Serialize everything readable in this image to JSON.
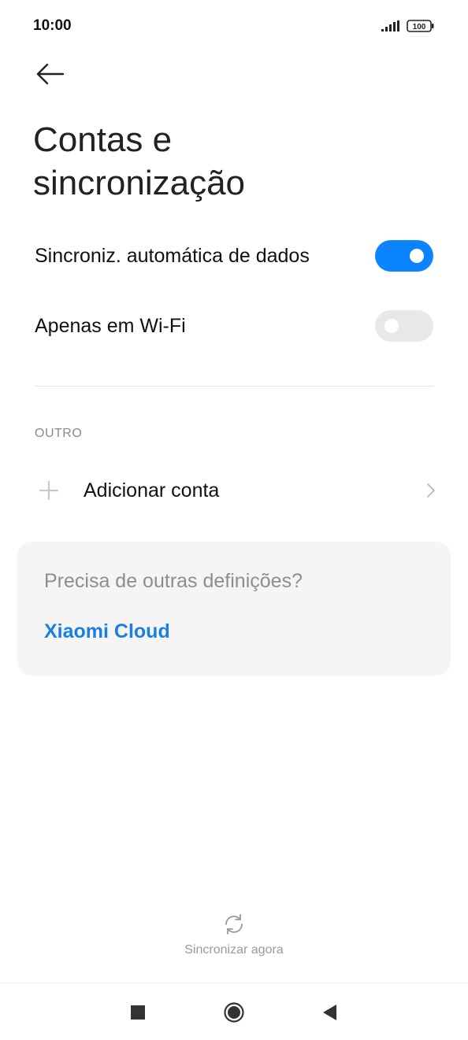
{
  "status_bar": {
    "time": "10:00",
    "battery": "100"
  },
  "header": {
    "title_line1": "Contas e",
    "title_line2": "sincronização"
  },
  "settings": [
    {
      "label": "Sincroniz. automática de dados",
      "state": "on"
    },
    {
      "label": "Apenas em Wi-Fi",
      "state": "off"
    }
  ],
  "other_section": {
    "header": "OUTRO",
    "add_account_label": "Adicionar conta"
  },
  "card": {
    "question": "Precisa de outras definições?",
    "link": "Xiaomi Cloud"
  },
  "sync_now": {
    "label": "Sincronizar agora"
  },
  "colors": {
    "accent": "#0d84ff",
    "link": "#1a7fe0",
    "toggle_off": "#e8e8e8"
  },
  "icons": [
    "back-arrow-icon",
    "signal-icon",
    "battery-icon",
    "plus-icon",
    "chevron-right-icon",
    "sync-icon",
    "recent-apps-icon",
    "home-icon",
    "back-icon"
  ]
}
